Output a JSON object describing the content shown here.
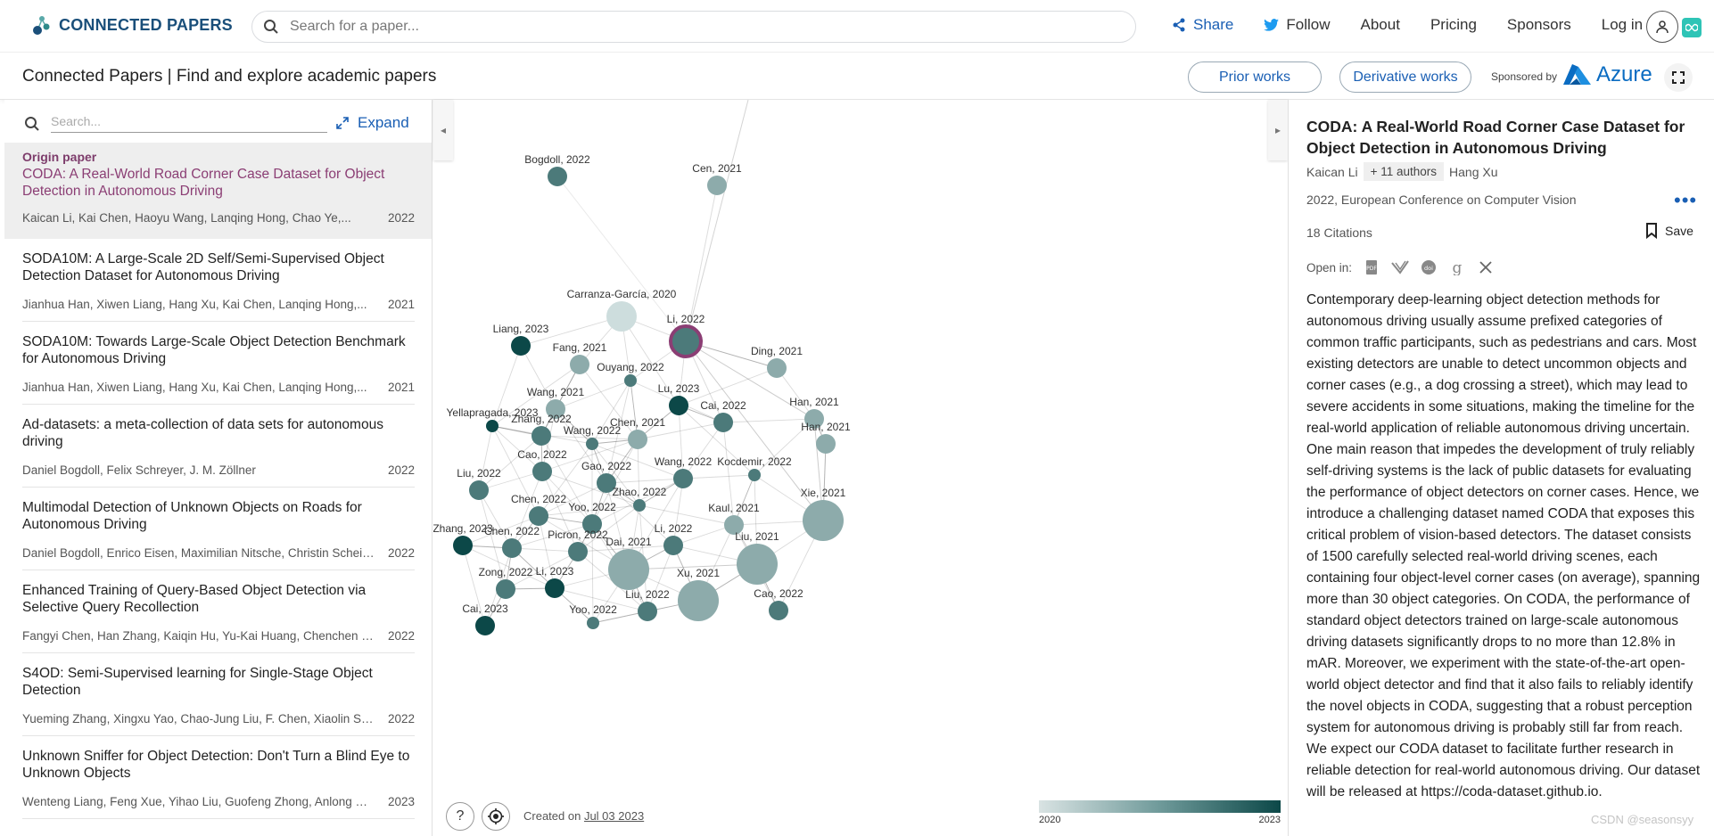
{
  "brand": {
    "name": "CONNECTED PAPERS"
  },
  "search": {
    "placeholder": "Search for a paper..."
  },
  "nav": {
    "share": "Share",
    "follow": "Follow",
    "about": "About",
    "pricing": "Pricing",
    "sponsors": "Sponsors",
    "login": "Log in"
  },
  "subheader": {
    "title": "Connected Papers | Find and explore academic papers",
    "prior": "Prior works",
    "derivative": "Derivative works",
    "sponsored": "Sponsored by",
    "azure": "Azure"
  },
  "left": {
    "search_placeholder": "Search...",
    "expand": "Expand",
    "origin_label": "Origin paper",
    "papers": [
      {
        "title": "CODA: A Real-World Road Corner Case Dataset for Object Detection in Autonomous Driving",
        "authors": "Kaican Li, Kai Chen, Haoyu Wang, Lanqing Hong, Chao Ye,...",
        "year": "2022"
      },
      {
        "title": "SODA10M: A Large-Scale 2D Self/Semi-Supervised Object Detection Dataset for Autonomous Driving",
        "authors": "Jianhua Han, Xiwen Liang, Hang Xu, Kai Chen, Lanqing Hong,...",
        "year": "2021"
      },
      {
        "title": "SODA10M: Towards Large-Scale Object Detection Benchmark for Autonomous Driving",
        "authors": "Jianhua Han, Xiwen Liang, Hang Xu, Kai Chen, Lanqing Hong,...",
        "year": "2021"
      },
      {
        "title": "Ad-datasets: a meta-collection of data sets for autonomous driving",
        "authors": "Daniel Bogdoll, Felix Schreyer, J. M. Zöllner",
        "year": "2022"
      },
      {
        "title": "Multimodal Detection of Unknown Objects on Roads for Autonomous Driving",
        "authors": "Daniel Bogdoll, Enrico Eisen, Maximilian Nitsche, Christin Scheib...",
        "year": "2022"
      },
      {
        "title": "Enhanced Training of Query-Based Object Detection via Selective Query Recollection",
        "authors": "Fangyi Chen, Han Zhang, Kaiqin Hu, Yu-Kai Huang, Chenchen Zh...",
        "year": "2022"
      },
      {
        "title": "S4OD: Semi-Supervised learning for Single-Stage Object Detection",
        "authors": "Yueming Zhang, Xingxu Yao, Chao-Jung Liu, F. Chen, Xiaolin Son...",
        "year": "2022"
      },
      {
        "title": "Unknown Sniffer for Object Detection: Don't Turn a Blind Eye to Unknown Objects",
        "authors": "Wenteng Liang, Feng Xue, Yihao Liu, Guofeng Zhong, Anlong Ming",
        "year": "2023"
      }
    ]
  },
  "graph": {
    "created_prefix": "Created on",
    "created_date": "Jul 03 2023",
    "legend_min": "2020",
    "legend_max": "2023",
    "nodes": [
      {
        "label": "Bogdoll, 2022",
        "year": 2022,
        "size": "small"
      },
      {
        "label": "Cen, 2021",
        "year": 2021,
        "size": "small"
      },
      {
        "label": "Carranza-García, 2020",
        "year": 2020,
        "size": "medium"
      },
      {
        "label": "Liang, 2023",
        "year": 2023,
        "size": "small"
      },
      {
        "label": "Li, 2022",
        "year": 2022,
        "size": "medium",
        "origin": true
      },
      {
        "label": "Fang, 2021",
        "year": 2021,
        "size": "small"
      },
      {
        "label": "Ding, 2021",
        "year": 2021,
        "size": "small"
      },
      {
        "label": "Ouyang, 2022",
        "year": 2022,
        "size": "tiny"
      },
      {
        "label": "Wang, 2021",
        "year": 2021,
        "size": "small"
      },
      {
        "label": "Lu, 2023",
        "year": 2023,
        "size": "small"
      },
      {
        "label": "Cai, 2022",
        "year": 2022,
        "size": "small"
      },
      {
        "label": "Han, 2021",
        "year": 2021,
        "size": "small"
      },
      {
        "label": "Yellapragada, 2023",
        "year": 2023,
        "size": "tiny"
      },
      {
        "label": "Zhang, 2022",
        "year": 2022,
        "size": "small"
      },
      {
        "label": "Han, 2021",
        "year": 2021,
        "size": "small"
      },
      {
        "label": "Wang, 2022",
        "year": 2022,
        "size": "tiny"
      },
      {
        "label": "Chen, 2021",
        "year": 2021,
        "size": "small"
      },
      {
        "label": "Cao, 2022",
        "year": 2022,
        "size": "small"
      },
      {
        "label": "Kocdemir, 2022",
        "year": 2022,
        "size": "tiny"
      },
      {
        "label": "Gao, 2022",
        "year": 2022,
        "size": "small"
      },
      {
        "label": "Wang, 2022",
        "year": 2022,
        "size": "small"
      },
      {
        "label": "Liu, 2022",
        "year": 2022,
        "size": "small"
      },
      {
        "label": "Zhao, 2022",
        "year": 2022,
        "size": "tiny"
      },
      {
        "label": "Chen, 2022",
        "year": 2022,
        "size": "small"
      },
      {
        "label": "Kaul, 2021",
        "year": 2021,
        "size": "small"
      },
      {
        "label": "Xie, 2021",
        "year": 2021,
        "size": "large"
      },
      {
        "label": "Yoo, 2022",
        "year": 2022,
        "size": "small"
      },
      {
        "label": "Zhang, 2023",
        "year": 2023,
        "size": "small"
      },
      {
        "label": "Chen, 2022",
        "year": 2022,
        "size": "small"
      },
      {
        "label": "Picron, 2022",
        "year": 2022,
        "size": "small"
      },
      {
        "label": "Li, 2022",
        "year": 2022,
        "size": "small"
      },
      {
        "label": "Dai, 2021",
        "year": 2021,
        "size": "large"
      },
      {
        "label": "Liu, 2021",
        "year": 2021,
        "size": "large"
      },
      {
        "label": "Zong, 2022",
        "year": 2022,
        "size": "small"
      },
      {
        "label": "Li, 2023",
        "year": 2023,
        "size": "small"
      },
      {
        "label": "Xu, 2021",
        "year": 2021,
        "size": "large"
      },
      {
        "label": "Liu, 2022",
        "year": 2022,
        "size": "small"
      },
      {
        "label": "Cao, 2022",
        "year": 2022,
        "size": "small"
      },
      {
        "label": "Cai, 2023",
        "year": 2023,
        "size": "small"
      },
      {
        "label": "Yoo, 2022",
        "year": 2022,
        "size": "tiny"
      }
    ]
  },
  "right": {
    "title": "CODA: A Real-World Road Corner Case Dataset for Object Detection in Autonomous Driving",
    "first_author": "Kaican Li",
    "more_authors": "+ 11 authors",
    "last_author": "Hang Xu",
    "venue": "2022, European Conference on Computer Vision",
    "citations": "18 Citations",
    "save": "Save",
    "open_in": "Open in:",
    "abstract": "Contemporary deep-learning object detection methods for autonomous driving usually assume prefixed categories of common traffic participants, such as pedestrians and cars. Most existing detectors are unable to detect uncommon objects and corner cases (e.g., a dog crossing a street), which may lead to severe accidents in some situations, making the timeline for the real-world application of reliable autonomous driving uncertain. One main reason that impedes the development of truly reliably self-driving systems is the lack of public datasets for evaluating the performance of object detectors on corner cases. Hence, we introduce a challenging dataset named CODA that exposes this critical problem of vision-based detectors. The dataset consists of 1500 carefully selected real-world driving scenes, each containing four object-level corner cases (on average), spanning more than 30 object categories. On CODA, the performance of standard object detectors trained on large-scale autonomous driving datasets significantly drops to no more than 12.8% in mAR. Moreover, we experiment with the state-of-the-art open-world object detector and find that it also fails to reliably identify the novel objects in CODA, suggesting that a robust perception system for autonomous driving is probably still far from reach. We expect our CODA dataset to facilitate further research in reliable detection for real-world autonomous driving. Our dataset will be released at https://coda-dataset.github.io."
  },
  "watermark": "CSDN @seasonsyy",
  "colors": {
    "accent": "#1a5fb4",
    "origin": "#8b3e74",
    "node_light": "#c5d6d6",
    "node_dark": "#0c4848"
  }
}
